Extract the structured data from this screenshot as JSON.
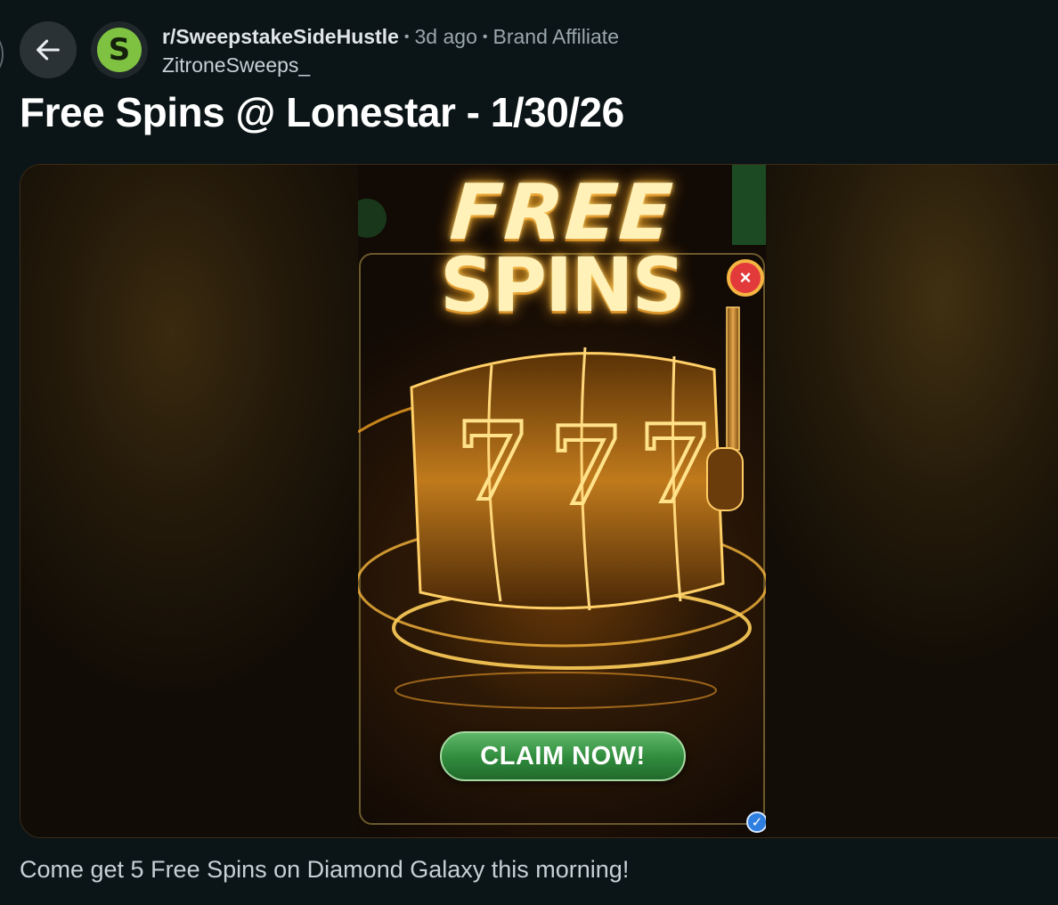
{
  "header": {
    "subreddit": "r/SweepstakeSideHustle",
    "age": "3d ago",
    "flair": "Brand Affiliate",
    "username": "ZitroneSweeps_",
    "avatar_letter": "S"
  },
  "post": {
    "title": "Free Spins @ Lonestar - 1/30/26",
    "body": "Come get 5 Free Spins on Diamond Galaxy this morning!"
  },
  "media": {
    "headline_line1": "FREE",
    "headline_line2": "SPINS",
    "reel_symbols": [
      "7",
      "7",
      "7"
    ],
    "cta_label": "CLAIM NOW!",
    "close_glyph": "×",
    "check_glyph": "✓"
  },
  "colors": {
    "background": "#0b1416",
    "avatar_accent": "#7fc241",
    "claim_button": "#2f8a3c",
    "close_badge": "#e23a3a",
    "gold_glow": "#f0a020"
  },
  "icons": {
    "back": "arrow-left-icon",
    "close": "close-icon",
    "verified": "check-icon"
  }
}
